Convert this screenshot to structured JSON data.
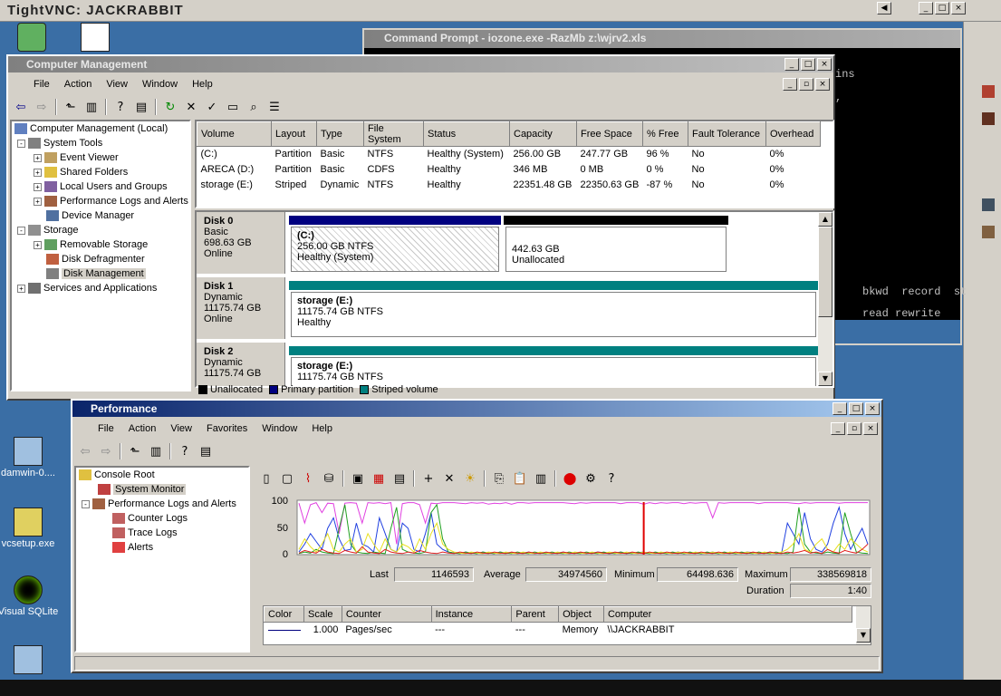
{
  "vnc": {
    "title": "TightVNC: JACKRABBIT"
  },
  "desktop_icons": [
    {
      "label": "damwin-0...."
    },
    {
      "label": "vcsetup.exe"
    },
    {
      "label": "Visual SQLite"
    }
  ],
  "cmd": {
    "title": "Command Prompt - iozone.exe -RazMb z:\\wjrv2.xls",
    "line1": "ins",
    "line2": ",",
    "line3": "bkwd  record  st",
    "line4": "read rewrite"
  },
  "cm": {
    "title": "Computer Management",
    "menu": [
      "File",
      "Action",
      "View",
      "Window",
      "Help"
    ],
    "tree": [
      {
        "label": "Computer Management (Local)"
      },
      {
        "label": "System Tools"
      },
      {
        "label": "Event Viewer"
      },
      {
        "label": "Shared Folders"
      },
      {
        "label": "Local Users and Groups"
      },
      {
        "label": "Performance Logs and Alerts"
      },
      {
        "label": "Device Manager"
      },
      {
        "label": "Storage"
      },
      {
        "label": "Removable Storage"
      },
      {
        "label": "Disk Defragmenter"
      },
      {
        "label": "Disk Management"
      },
      {
        "label": "Services and Applications"
      }
    ],
    "columns": [
      "Volume",
      "Layout",
      "Type",
      "File System",
      "Status",
      "Capacity",
      "Free Space",
      "% Free",
      "Fault Tolerance",
      "Overhead"
    ],
    "volumes": [
      [
        "(C:)",
        "Partition",
        "Basic",
        "NTFS",
        "Healthy (System)",
        "256.00 GB",
        "247.77 GB",
        "96 %",
        "No",
        "0%"
      ],
      [
        "ARECA (D:)",
        "Partition",
        "Basic",
        "CDFS",
        "Healthy",
        "346 MB",
        "0 MB",
        "0 %",
        "No",
        "0%"
      ],
      [
        "storage (E:)",
        "Striped",
        "Dynamic",
        "NTFS",
        "Healthy",
        "22351.48 GB",
        "22350.63 GB",
        "-87 %",
        "No",
        "0%"
      ]
    ],
    "disks": [
      {
        "name": "Disk 0",
        "type": "Basic",
        "size": "698.63 GB",
        "status": "Online",
        "p1_name": "(C:)",
        "p1_size": "256.00 GB NTFS",
        "p1_status": "Healthy (System)",
        "p2_size": "442.63 GB",
        "p2_status": "Unallocated"
      },
      {
        "name": "Disk 1",
        "type": "Dynamic",
        "size": "11175.74 GB",
        "status": "Online",
        "p1_name": "storage  (E:)",
        "p1_size": "11175.74 GB NTFS",
        "p1_status": "Healthy"
      },
      {
        "name": "Disk 2",
        "type": "Dynamic",
        "size": "11175.74 GB",
        "status": "",
        "p1_name": "storage  (E:)",
        "p1_size": "11175.74 GB NTFS",
        "p1_status": ""
      }
    ],
    "legend": [
      "Unallocated",
      "Primary partition",
      "Striped volume"
    ],
    "colors": {
      "unallocated": "#000000",
      "primary": "#000080",
      "striped": "#008080"
    }
  },
  "perf": {
    "title": "Performance",
    "menu": [
      "File",
      "Action",
      "View",
      "Favorites",
      "Window",
      "Help"
    ],
    "tree": [
      {
        "label": "Console Root"
      },
      {
        "label": "System Monitor"
      },
      {
        "label": "Performance Logs and Alerts"
      },
      {
        "label": "Counter Logs"
      },
      {
        "label": "Trace Logs"
      },
      {
        "label": "Alerts"
      }
    ],
    "stats": {
      "last_label": "Last",
      "last": "1146593",
      "avg_label": "Average",
      "avg": "34974560",
      "min_label": "Minimum",
      "min": "64498.636",
      "max_label": "Maximum",
      "max": "338569818",
      "dur_label": "Duration",
      "dur": "1:40"
    },
    "counter_columns": [
      "Color",
      "Scale",
      "Counter",
      "Instance",
      "Parent",
      "Object",
      "Computer"
    ],
    "counter_row": [
      "",
      "1.000",
      "Pages/sec",
      "---",
      "---",
      "Memory",
      "\\\\JACKRABBIT"
    ]
  },
  "chart_data": {
    "type": "line",
    "ylim": [
      0,
      100
    ],
    "yticks": [
      "100",
      "50",
      "0"
    ],
    "x": [
      0,
      1,
      2,
      3,
      4,
      5,
      6,
      7,
      8,
      9,
      10,
      11,
      12,
      13,
      14,
      15,
      16,
      17,
      18,
      19,
      20,
      21,
      22,
      23,
      24,
      25,
      26,
      27,
      28,
      29,
      30,
      31,
      32,
      33,
      34,
      35,
      36,
      37,
      38,
      39,
      40,
      41,
      42,
      43,
      44,
      45,
      46,
      47,
      48,
      49,
      50,
      51,
      52,
      53,
      54,
      55,
      56,
      57,
      58,
      59,
      60,
      61,
      62,
      63,
      64,
      65,
      66,
      67,
      68,
      69,
      70,
      71,
      72,
      73,
      74,
      75,
      76,
      77,
      78,
      79,
      80,
      81,
      82,
      83,
      84,
      85,
      86,
      87,
      88,
      89,
      90,
      91,
      92,
      93,
      94,
      95,
      96,
      97,
      98,
      99
    ],
    "series": [
      {
        "color": "#e040e0",
        "values": [
          98,
          60,
          95,
          99,
          80,
          98,
          97,
          40,
          98,
          99,
          98,
          60,
          99,
          98,
          99,
          97,
          99,
          20,
          97,
          99,
          99,
          95,
          60,
          98,
          97,
          99,
          99,
          99,
          98,
          97,
          99,
          98,
          99,
          96,
          98,
          97,
          99,
          96,
          99,
          99,
          98,
          99,
          99,
          99,
          99,
          99,
          99,
          98,
          97,
          99,
          98,
          99,
          99,
          99,
          99,
          99,
          97,
          99,
          99,
          99,
          96,
          99,
          97,
          99,
          98,
          99,
          99,
          97,
          99,
          98,
          99,
          99,
          70,
          99,
          98,
          99,
          99,
          99,
          99,
          99,
          97,
          99,
          99,
          99,
          99,
          99,
          98,
          97,
          99,
          98,
          99,
          99,
          99,
          99,
          98,
          99,
          99,
          99,
          99,
          99
        ]
      },
      {
        "color": "#2040e0",
        "values": [
          5,
          20,
          40,
          25,
          10,
          50,
          70,
          30,
          8,
          10,
          60,
          20,
          15,
          5,
          70,
          40,
          10,
          5,
          60,
          50,
          10,
          5,
          40,
          80,
          20,
          10,
          5,
          3,
          2,
          5,
          3,
          2,
          5,
          3,
          2,
          5,
          3,
          4,
          2,
          3,
          5,
          2,
          3,
          4,
          2,
          3,
          5,
          2,
          3,
          4,
          2,
          3,
          5,
          4,
          2,
          3,
          5,
          2,
          3,
          4,
          5,
          2,
          3,
          4,
          2,
          3,
          5,
          2,
          3,
          4,
          2,
          3,
          5,
          2,
          3,
          4,
          2,
          3,
          5,
          4,
          2,
          3,
          5,
          2,
          3,
          60,
          40,
          20,
          80,
          30,
          10,
          5,
          20,
          60,
          90,
          40,
          10,
          30,
          50,
          20
        ]
      },
      {
        "color": "#20a020",
        "values": [
          2,
          5,
          3,
          10,
          5,
          3,
          2,
          50,
          95,
          20,
          5,
          3,
          2,
          5,
          3,
          2,
          50,
          90,
          10,
          5,
          3,
          2,
          5,
          80,
          95,
          30,
          5,
          3,
          2,
          5,
          3,
          2,
          5,
          3,
          2,
          5,
          3,
          2,
          5,
          3,
          2,
          5,
          3,
          2,
          5,
          3,
          2,
          5,
          3,
          2,
          5,
          3,
          2,
          5,
          3,
          2,
          5,
          3,
          2,
          5,
          3,
          2,
          5,
          3,
          2,
          5,
          3,
          2,
          5,
          3,
          2,
          5,
          3,
          2,
          5,
          3,
          2,
          5,
          3,
          2,
          5,
          3,
          2,
          5,
          3,
          2,
          5,
          90,
          20,
          5,
          3,
          2,
          5,
          3,
          2,
          80,
          40,
          5,
          3,
          2
        ]
      },
      {
        "color": "#e8e020",
        "values": [
          10,
          30,
          15,
          5,
          20,
          40,
          10,
          5,
          20,
          30,
          5,
          10,
          40,
          20,
          5,
          30,
          10,
          5,
          20,
          15,
          5,
          30,
          10,
          40,
          60,
          20,
          10,
          5,
          3,
          2,
          5,
          3,
          2,
          5,
          3,
          2,
          5,
          3,
          2,
          5,
          3,
          2,
          5,
          3,
          2,
          5,
          3,
          2,
          5,
          3,
          2,
          5,
          3,
          2,
          5,
          3,
          2,
          5,
          3,
          2,
          5,
          3,
          2,
          5,
          3,
          2,
          5,
          3,
          2,
          5,
          3,
          2,
          5,
          3,
          2,
          5,
          3,
          2,
          5,
          3,
          2,
          5,
          3,
          2,
          5,
          10,
          20,
          40,
          10,
          5,
          20,
          30,
          10,
          5,
          20,
          10,
          30,
          20,
          10,
          5
        ]
      },
      {
        "color": "#e02020",
        "values": [
          3,
          8,
          5,
          3,
          10,
          5,
          3,
          2,
          8,
          5,
          3,
          15,
          5,
          3,
          2,
          10,
          5,
          3,
          2,
          5,
          3,
          8,
          5,
          3,
          2,
          5,
          3,
          2,
          5,
          3,
          2,
          5,
          3,
          2,
          5,
          3,
          2,
          5,
          3,
          2,
          5,
          3,
          2,
          5,
          3,
          2,
          5,
          3,
          2,
          5,
          3,
          2,
          5,
          3,
          2,
          5,
          3,
          2,
          5,
          3,
          2,
          5,
          3,
          2,
          5,
          3,
          2,
          5,
          3,
          2,
          5,
          3,
          2,
          5,
          3,
          2,
          5,
          3,
          2,
          5,
          3,
          2,
          5,
          3,
          2,
          5,
          3,
          5,
          8,
          3,
          5,
          2,
          10,
          5,
          3,
          8,
          5,
          3,
          10,
          20
        ]
      }
    ],
    "spike_line": {
      "color": "#e00000",
      "x": 60
    }
  }
}
